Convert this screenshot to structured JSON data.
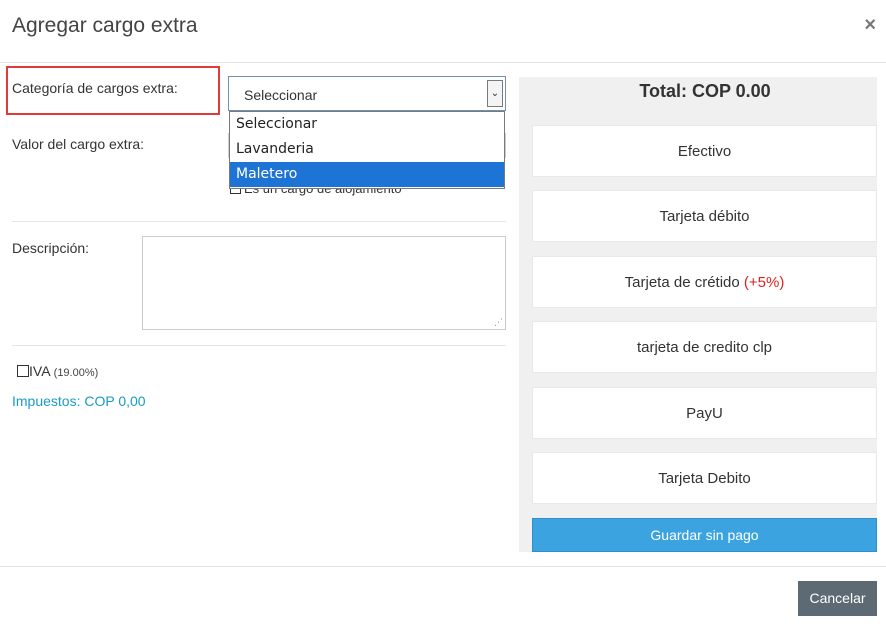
{
  "modal": {
    "title": "Agregar cargo extra",
    "close_label": "×"
  },
  "form": {
    "category_label": "Categoría de cargos extra:",
    "value_label": "Valor del cargo extra:",
    "select": {
      "selected": "Seleccionar",
      "options": [
        "Seleccionar",
        "Lavanderia",
        "Maletero"
      ],
      "highlighted": "Maletero"
    },
    "lodging_charge_label": "Es un cargo de alojamiento",
    "description_label": "Descripción:",
    "iva_label": "IVA",
    "iva_rate": "(19.00%)",
    "taxes_text": "Impuestos: COP 0,00"
  },
  "payment": {
    "total": "Total: COP 0.00",
    "methods": [
      {
        "label": "Efectivo",
        "extra": ""
      },
      {
        "label": "Tarjeta débito",
        "extra": ""
      },
      {
        "label": "Tarjeta de crétido",
        "extra": "(+5%)"
      },
      {
        "label": "tarjeta de credito clp",
        "extra": ""
      },
      {
        "label": "PayU",
        "extra": ""
      },
      {
        "label": "Tarjeta Debito",
        "extra": ""
      }
    ],
    "save_without_payment": "Guardar sin pago"
  },
  "footer": {
    "cancel": "Cancelar"
  },
  "colors": {
    "highlight_border": "#e03a3a",
    "selected_option": "#1e74d4",
    "save_button": "#3aa3e0",
    "taxes_text": "#1a9bc4",
    "cancel_button": "#5d6a73",
    "surcharge": "#d9231f"
  }
}
